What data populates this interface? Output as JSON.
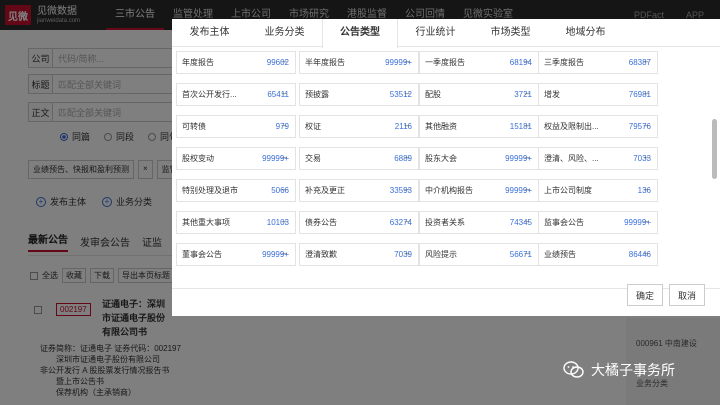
{
  "topbar": {
    "logo_mark": "见微",
    "logo_cn": "见微数据",
    "logo_en": "jianweidata.com",
    "nav": [
      "三市公告",
      "监管处理",
      "上市公司",
      "市场研究",
      "港股监督",
      "公司回情",
      "见微实验室"
    ],
    "right": [
      "PDFact",
      "APP"
    ]
  },
  "form": {
    "company_label": "公司",
    "company_placeholder": "代码/简称...",
    "title_label": "标题",
    "title_placeholder": "匹配全部关键词",
    "body_label": "正文",
    "body_placeholder": "匹配全部关键词",
    "radios": [
      "同篇",
      "同段",
      "同句"
    ],
    "chips": [
      "业绩预告、快报和盈利预测",
      "×",
      "监管"
    ],
    "filters": [
      "发布主体",
      "业务分类"
    ]
  },
  "list": {
    "tabs": [
      "最新公告",
      "发审会公告",
      "证监"
    ],
    "toolbar": [
      "全选",
      "收藏",
      "下载",
      "导出本页标题"
    ],
    "result_code": "002197",
    "result_title": "证通电子：深圳市证通电子股份有限公司书",
    "summary": [
      "证券简称：证通电子 证券代码：002197",
      "深圳市证通电子股份有限公司",
      "非公开发行 A 股股票发行情况报告书",
      "暨上市公告书",
      "保荐机构（主承销商）"
    ]
  },
  "right_panel": {
    "line1": "000961 中南建设",
    "line2": "业务分类"
  },
  "modal": {
    "tabs": [
      "发布主体",
      "业务分类",
      "公告类型",
      "行业统计",
      "市场类型",
      "地域分布"
    ],
    "active_tab": 2,
    "items": [
      [
        {
          "name": "年度报告",
          "count": "99602"
        },
        {
          "name": "半年度报告",
          "count": "99999+"
        },
        {
          "name": "一季度报告",
          "count": "68194"
        },
        {
          "name": "三季度报告",
          "count": "68387"
        }
      ],
      [
        {
          "name": "首次公开发行...",
          "count": "65411"
        },
        {
          "name": "预披露",
          "count": "53512"
        },
        {
          "name": "配股",
          "count": "3721"
        },
        {
          "name": "增发",
          "count": "76981"
        }
      ],
      [
        {
          "name": "可转债",
          "count": "979"
        },
        {
          "name": "权证",
          "count": "2116"
        },
        {
          "name": "其他融资",
          "count": "15181"
        },
        {
          "name": "权益及限制出...",
          "count": "79576"
        }
      ],
      [
        {
          "name": "股权变动",
          "count": "99999+"
        },
        {
          "name": "交易",
          "count": "6889"
        },
        {
          "name": "股东大会",
          "count": "99999+"
        },
        {
          "name": "澄清、风险、...",
          "count": "7033"
        }
      ],
      [
        {
          "name": "特别处理及退市",
          "count": "5066"
        },
        {
          "name": "补充及更正",
          "count": "33593"
        },
        {
          "name": "中介机构报告",
          "count": "99999+"
        },
        {
          "name": "上市公司制度",
          "count": "136"
        }
      ],
      [
        {
          "name": "其他重大事项",
          "count": "10103"
        },
        {
          "name": "债券公告",
          "count": "63274"
        },
        {
          "name": "投资者关系",
          "count": "74345"
        },
        {
          "name": "监事会公告",
          "count": "99999+"
        }
      ],
      [
        {
          "name": "董事会公告",
          "count": "99999+"
        },
        {
          "name": "澄清致歉",
          "count": "7039"
        },
        {
          "name": "风险提示",
          "count": "56671"
        },
        {
          "name": "业绩预告",
          "count": "86446"
        }
      ]
    ],
    "dash_symbol": "–",
    "confirm": "确定",
    "cancel": "取消"
  },
  "watermark": {
    "text": "大橘子事务所"
  },
  "colors": {
    "brand": "#c8102e",
    "link": "#3a6fd8",
    "topbar": "#2b2b2b"
  }
}
